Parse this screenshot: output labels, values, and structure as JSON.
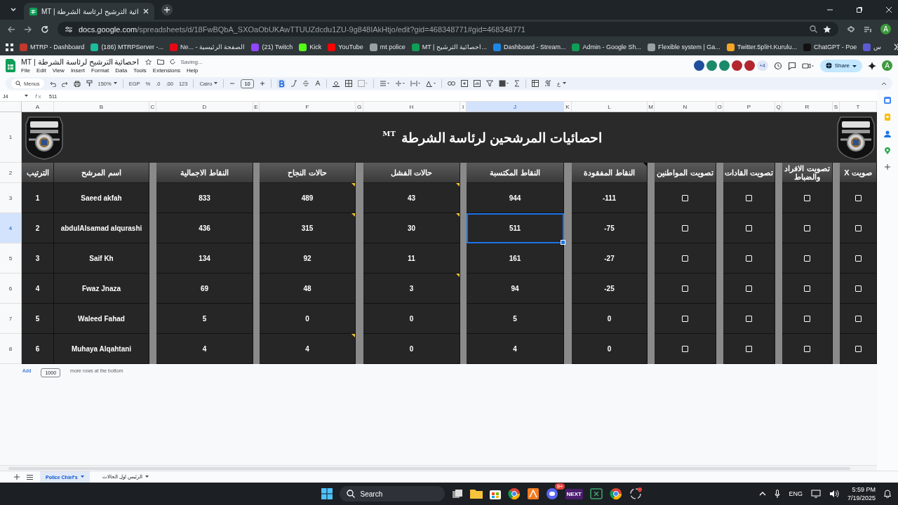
{
  "browser": {
    "tab_title": "MT | ائية الترشيح لرئاسة الشرطة",
    "address": "docs.google.com/spreadsheets/d/18FwBQbA_SXOaObUKAwTTUUZdcdu1ZU-9g848IAkHtjo/edit?gid=468348771#gid=468348771",
    "profile": "A",
    "bookmarks": [
      {
        "label": "MTRP - Dashboard",
        "color": "#c0392b"
      },
      {
        "label": "(186) MTRPServer -...",
        "color": "#1abc9c"
      },
      {
        "label": "Ne... - الصفحة الرئيسية",
        "color": "#e50914"
      },
      {
        "label": "(21) Twitch",
        "color": "#9146ff"
      },
      {
        "label": "Kick",
        "color": "#53fc18"
      },
      {
        "label": "YouTube",
        "color": "#ff0000"
      },
      {
        "label": "mt police",
        "color": "#9aa0a6"
      },
      {
        "label": "MT | احصائية الترشيح...",
        "color": "#0f9d58"
      },
      {
        "label": "Dashboard - Stream...",
        "color": "#1e88e5"
      },
      {
        "label": "Admin - Google Sh...",
        "color": "#0f9d58"
      },
      {
        "label": "Flexible system | Ga...",
        "color": "#9aa0a6"
      },
      {
        "label": "Twitter.5pliH.Kurulu...",
        "color": "#f5a623"
      },
      {
        "label": "ChatGPT - Poe",
        "color": "#111111"
      },
      {
        "label": "س",
        "color": "#5b5bd6"
      }
    ]
  },
  "sheet": {
    "title": "احصائية الترشيح لرئاسة الشرطة | MT",
    "status": "Saving...",
    "menus": [
      "File",
      "Edit",
      "View",
      "Insert",
      "Format",
      "Data",
      "Tools",
      "Extensions",
      "Help"
    ],
    "collaborators": [
      {
        "color": "#1f4e9c"
      },
      {
        "color": "#1b8a6b"
      },
      {
        "color": "#1b8a6b"
      },
      {
        "color": "#b3262d"
      },
      {
        "color": "#b3262d"
      }
    ],
    "more_collaborators": "+4",
    "share": "Share",
    "avatar": "A",
    "toolbar": {
      "search": "Menus",
      "zoom": "150%",
      "currency": "EGP",
      "percent": "%",
      "decrease_decimals": ".0",
      "increase_decimals": ".00",
      "number_format": "123",
      "font": "Cairo",
      "font_size": "10",
      "bold": true,
      "text_direction": "ع"
    }
  },
  "formula_bar": {
    "cell": "J4",
    "value": "511"
  },
  "column_letters": [
    {
      "label": "A",
      "selected": false
    },
    {
      "label": "B",
      "selected": false
    },
    {
      "label": "C",
      "selected": false
    },
    {
      "label": "D",
      "selected": false
    },
    {
      "label": "E",
      "selected": false
    },
    {
      "label": "F",
      "selected": false
    },
    {
      "label": "G",
      "selected": false
    },
    {
      "label": "H",
      "selected": false
    },
    {
      "label": "I",
      "selected": false
    },
    {
      "label": "J",
      "selected": true
    },
    {
      "label": "K",
      "selected": false
    },
    {
      "label": "L",
      "selected": false
    },
    {
      "label": "M",
      "selected": false
    },
    {
      "label": "N",
      "selected": false
    },
    {
      "label": "O",
      "selected": false
    },
    {
      "label": "P",
      "selected": false
    },
    {
      "label": "Q",
      "selected": false
    },
    {
      "label": "R",
      "selected": false
    },
    {
      "label": "S",
      "selected": false
    },
    {
      "label": "T",
      "selected": false
    }
  ],
  "row_numbers": [
    {
      "label": "1",
      "selected": false
    },
    {
      "label": "2",
      "selected": false
    },
    {
      "label": "3",
      "selected": false
    },
    {
      "label": "4",
      "selected": true
    },
    {
      "label": "5",
      "selected": false
    },
    {
      "label": "6",
      "selected": false
    },
    {
      "label": "7",
      "selected": false
    },
    {
      "label": "8",
      "selected": false
    }
  ],
  "grid": {
    "title": "احصائيات المرشحين لرئاسة الشرطة",
    "title_mark": "MT",
    "headers": {
      "A": {
        "text": "الترتيب",
        "note": false
      },
      "B": {
        "text": "اسم المرشح",
        "note": false
      },
      "D": {
        "text": "النقاط الاجمالية",
        "note": false
      },
      "F": {
        "text": "حالات النجاح",
        "note": false
      },
      "H": {
        "text": "حالات الفشل",
        "note": false
      },
      "J": {
        "text": "النقاط المكتسبة",
        "note": false
      },
      "L": {
        "text": "النقاط المفقودة",
        "note": true
      },
      "N": {
        "text": "تصويت المواطنين",
        "note": false
      },
      "P": {
        "text": "تصويت القادات",
        "note": false
      },
      "R": {
        "text": "تصويت الافراد والضباط",
        "note": false
      },
      "T": {
        "text": "صويت X",
        "note": false
      }
    },
    "rows": [
      {
        "cells": [
          {
            "kind": "text",
            "text": "1",
            "note": false,
            "selected": false
          },
          {
            "kind": "text",
            "text": "Saeed akfah",
            "note": false,
            "selected": false
          },
          {
            "kind": "text",
            "text": "833",
            "note": false,
            "selected": false
          },
          {
            "kind": "text",
            "text": "489",
            "note": true,
            "selected": false
          },
          {
            "kind": "text",
            "text": "43",
            "note": true,
            "selected": false
          },
          {
            "kind": "text",
            "text": "944",
            "note": false,
            "selected": false
          },
          {
            "kind": "text",
            "text": "-111",
            "note": false,
            "selected": false
          },
          {
            "kind": "checkbox",
            "checked": false,
            "selected": false
          },
          {
            "kind": "checkbox",
            "checked": false,
            "selected": false
          },
          {
            "kind": "checkbox",
            "checked": false,
            "selected": false
          },
          {
            "kind": "checkbox",
            "checked": false,
            "selected": false
          }
        ]
      },
      {
        "cells": [
          {
            "kind": "text",
            "text": "2",
            "note": false,
            "selected": false
          },
          {
            "kind": "text",
            "text": "abdulAlsamad alqurashi",
            "note": false,
            "selected": false
          },
          {
            "kind": "text",
            "text": "436",
            "note": false,
            "selected": false
          },
          {
            "kind": "text",
            "text": "315",
            "note": true,
            "selected": false
          },
          {
            "kind": "text",
            "text": "30",
            "note": true,
            "selected": false
          },
          {
            "kind": "text",
            "text": "511",
            "note": false,
            "selected": true
          },
          {
            "kind": "text",
            "text": "-75",
            "note": false,
            "selected": false
          },
          {
            "kind": "checkbox",
            "checked": false,
            "selected": false
          },
          {
            "kind": "checkbox",
            "checked": false,
            "selected": false
          },
          {
            "kind": "checkbox",
            "checked": false,
            "selected": false
          },
          {
            "kind": "checkbox",
            "checked": false,
            "selected": false
          }
        ]
      },
      {
        "cells": [
          {
            "kind": "text",
            "text": "3",
            "note": false,
            "selected": false
          },
          {
            "kind": "text",
            "text": "Saif Kh",
            "note": false,
            "selected": false
          },
          {
            "kind": "text",
            "text": "134",
            "note": false,
            "selected": false
          },
          {
            "kind": "text",
            "text": "92",
            "note": false,
            "selected": false
          },
          {
            "kind": "text",
            "text": "11",
            "note": false,
            "selected": false
          },
          {
            "kind": "text",
            "text": "161",
            "note": false,
            "selected": false
          },
          {
            "kind": "text",
            "text": "-27",
            "note": false,
            "selected": false
          },
          {
            "kind": "checkbox",
            "checked": false,
            "selected": false
          },
          {
            "kind": "checkbox",
            "checked": false,
            "selected": false
          },
          {
            "kind": "checkbox",
            "checked": false,
            "selected": false
          },
          {
            "kind": "checkbox",
            "checked": false,
            "selected": false
          }
        ]
      },
      {
        "cells": [
          {
            "kind": "text",
            "text": "4",
            "note": false,
            "selected": false
          },
          {
            "kind": "text",
            "text": "Fwaz Jnaza",
            "note": false,
            "selected": false
          },
          {
            "kind": "text",
            "text": "69",
            "note": false,
            "selected": false
          },
          {
            "kind": "text",
            "text": "48",
            "note": false,
            "selected": false
          },
          {
            "kind": "text",
            "text": "3",
            "note": true,
            "selected": false
          },
          {
            "kind": "text",
            "text": "94",
            "note": false,
            "selected": false
          },
          {
            "kind": "text",
            "text": "-25",
            "note": false,
            "selected": false
          },
          {
            "kind": "checkbox",
            "checked": false,
            "selected": false
          },
          {
            "kind": "checkbox",
            "checked": false,
            "selected": false
          },
          {
            "kind": "checkbox",
            "checked": false,
            "selected": false
          },
          {
            "kind": "checkbox",
            "checked": false,
            "selected": false
          }
        ]
      },
      {
        "cells": [
          {
            "kind": "text",
            "text": "5",
            "note": false,
            "selected": false
          },
          {
            "kind": "text",
            "text": "Waleed Fahad",
            "note": false,
            "selected": false
          },
          {
            "kind": "text",
            "text": "5",
            "note": false,
            "selected": false
          },
          {
            "kind": "text",
            "text": "0",
            "note": false,
            "selected": false
          },
          {
            "kind": "text",
            "text": "0",
            "note": false,
            "selected": false
          },
          {
            "kind": "text",
            "text": "5",
            "note": false,
            "selected": false
          },
          {
            "kind": "text",
            "text": "0",
            "note": false,
            "selected": false
          },
          {
            "kind": "checkbox",
            "checked": false,
            "selected": false
          },
          {
            "kind": "checkbox",
            "checked": false,
            "selected": false
          },
          {
            "kind": "checkbox",
            "checked": false,
            "selected": false
          },
          {
            "kind": "checkbox",
            "checked": false,
            "selected": false
          }
        ]
      },
      {
        "cells": [
          {
            "kind": "text",
            "text": "6",
            "note": false,
            "selected": false
          },
          {
            "kind": "text",
            "text": "Muhaya Alqahtani",
            "note": false,
            "selected": false
          },
          {
            "kind": "text",
            "text": "4",
            "note": false,
            "selected": false
          },
          {
            "kind": "text",
            "text": "4",
            "note": true,
            "selected": false
          },
          {
            "kind": "text",
            "text": "0",
            "note": false,
            "selected": false
          },
          {
            "kind": "text",
            "text": "4",
            "note": false,
            "selected": false
          },
          {
            "kind": "text",
            "text": "0",
            "note": false,
            "selected": false
          },
          {
            "kind": "checkbox",
            "checked": false,
            "selected": false
          },
          {
            "kind": "checkbox",
            "checked": false,
            "selected": false
          },
          {
            "kind": "checkbox",
            "checked": false,
            "selected": false
          },
          {
            "kind": "checkbox",
            "checked": false,
            "selected": false
          }
        ]
      }
    ]
  },
  "add_rows": {
    "button": "Add",
    "count": "1000",
    "text": "more rows at the bottom"
  },
  "sheet_tabs": [
    {
      "label": "Police Chief's",
      "selected": true
    },
    {
      "label": "الرئيس اول الحالات",
      "selected": false
    }
  ],
  "taskbar": {
    "search": "Search",
    "badge": "9+",
    "app_label": "NEXT",
    "language": "ENG",
    "time": "5:59 PM",
    "date": "7/19/2025"
  }
}
